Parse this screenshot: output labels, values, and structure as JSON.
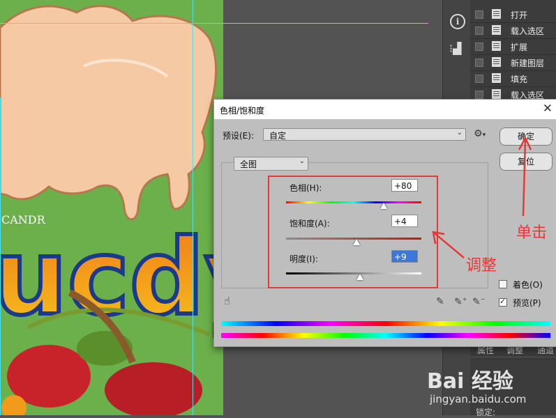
{
  "canvas": {
    "brand_text_small": "CANDR",
    "brand_text_large": "ucdy"
  },
  "history": {
    "items": [
      {
        "label": "打开"
      },
      {
        "label": "载入选区"
      },
      {
        "label": "扩展"
      },
      {
        "label": "新建图层"
      },
      {
        "label": "填充"
      },
      {
        "label": "载入选区"
      }
    ]
  },
  "properties_panel": {
    "tabs": [
      "属性",
      "调整",
      "通道"
    ],
    "lock_label": "锁定:"
  },
  "dialog": {
    "title": "色相/饱和度",
    "close_glyph": "✕",
    "preset_label": "预设(E):",
    "preset_value": "自定",
    "channel_value": "全图",
    "ok_label": "确定",
    "reset_label": "复位",
    "colorize_label": "着色(O)",
    "colorize_checked": false,
    "preview_label": "预览(P)",
    "preview_checked": true,
    "sliders": [
      {
        "label": "色相(H):",
        "value": "+80",
        "level": 80,
        "min": -180,
        "max": 180
      },
      {
        "label": "饱和度(A):",
        "value": "+4",
        "level": 4,
        "min": -100,
        "max": 100
      },
      {
        "label": "明度(I):",
        "value": "+9",
        "level": 9,
        "min": -100,
        "max": 100
      }
    ]
  },
  "annotations": {
    "adjust": "调整",
    "click": "单击"
  },
  "watermark": {
    "logo": "Bai 经验",
    "url": "jingyan.baidu.com"
  },
  "colors": {
    "annotation_red": "#e53935",
    "dialog_bg": "#bebebe",
    "panel_dark": "#3c3c3c"
  }
}
